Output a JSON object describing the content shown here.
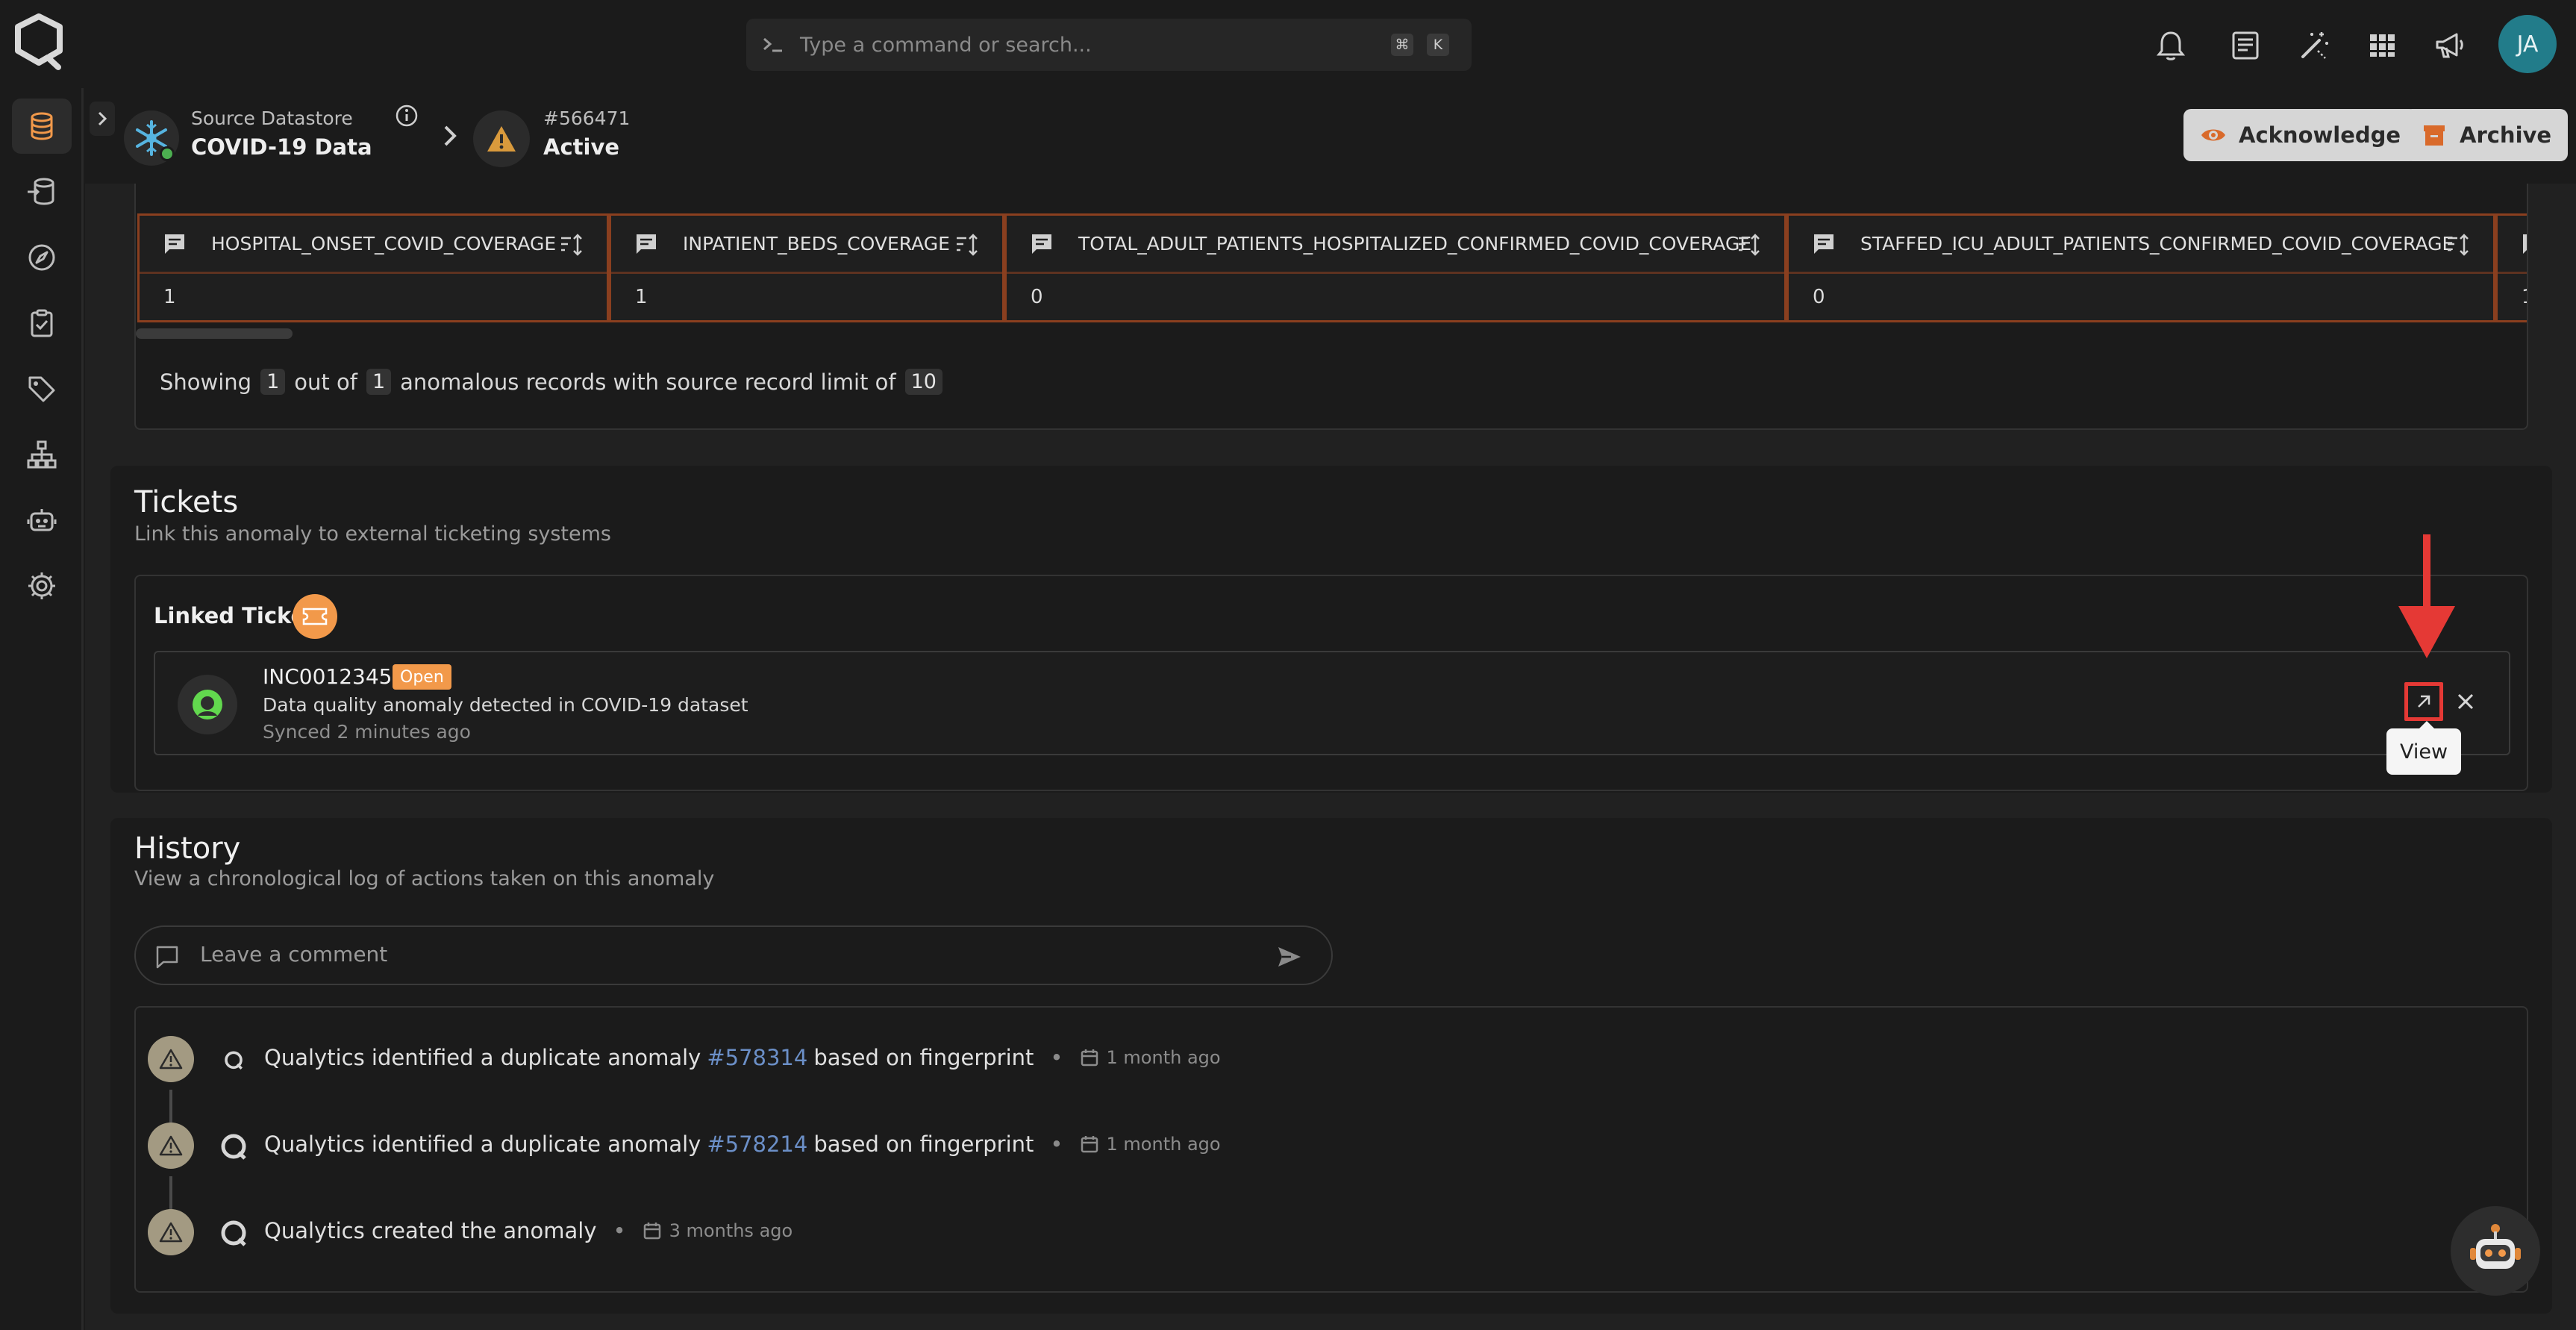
{
  "topbar": {
    "search_placeholder": "Type a command or search...",
    "shortcut_mod": "⌘",
    "shortcut_key": "K",
    "avatar_initials": "JA"
  },
  "header": {
    "datastore_label": "Source Datastore",
    "datastore_name": "COVID-19 Data",
    "anomaly_id": "#566471",
    "anomaly_status": "Active",
    "acknowledge_label": "Acknowledge",
    "archive_label": "Archive"
  },
  "records": {
    "columns": [
      {
        "name": "HOSPITAL_ONSET_COVID_COVERAGE",
        "value": "1"
      },
      {
        "name": "INPATIENT_BEDS_COVERAGE",
        "value": "1"
      },
      {
        "name": "TOTAL_ADULT_PATIENTS_HOSPITALIZED_CONFIRMED_COVID_COVERAGE",
        "value": "0"
      },
      {
        "name": "STAFFED_ICU_ADULT_PATIENTS_CONFIRMED_COVID_COVERAGE",
        "value": "0"
      },
      {
        "name": "",
        "value": "1"
      }
    ],
    "showing_prefix": "Showing",
    "shown_count": "1",
    "out_of_label": "out of",
    "total_count": "1",
    "limit_text": "anomalous records with source record limit of",
    "limit_value": "10"
  },
  "tickets": {
    "title": "Tickets",
    "subtitle": "Link this anomaly to external ticketing systems",
    "linked_title": "Linked Tickets",
    "ticket": {
      "id": "INC0012345",
      "status": "Open",
      "description": "Data quality anomaly detected in COVID-19 dataset",
      "synced": "Synced 2 minutes ago"
    },
    "tooltip": "View"
  },
  "history": {
    "title": "History",
    "subtitle": "View a chronological log of actions taken on this anomaly",
    "comment_placeholder": "Leave a comment",
    "entries": [
      {
        "prefix": "Qualytics identified a duplicate anomaly",
        "link": "#578314",
        "suffix": "based on fingerprint",
        "date": "1 month ago"
      },
      {
        "prefix": "Qualytics identified a duplicate anomaly",
        "link": "#578214",
        "suffix": "based on fingerprint",
        "date": "1 month ago"
      },
      {
        "prefix": "Qualytics created the anomaly",
        "link": "",
        "suffix": "",
        "date": "3 months ago"
      }
    ]
  },
  "colors": {
    "accent_orange": "#f2994a",
    "highlight_red": "#e53935",
    "column_border": "#8a3f1f",
    "link_blue": "#6b8fc7"
  }
}
